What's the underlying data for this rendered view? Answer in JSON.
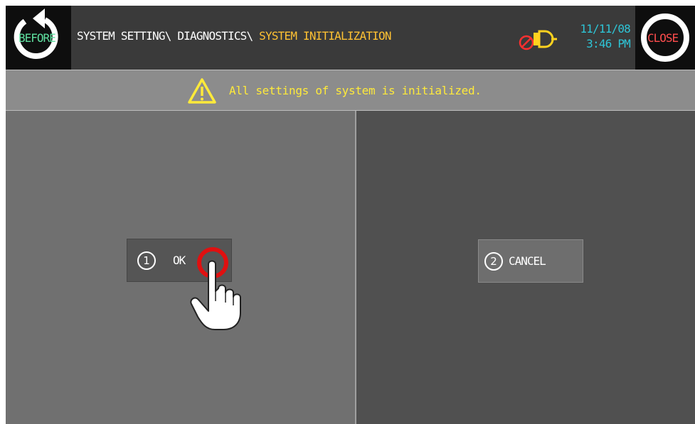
{
  "header": {
    "before_label": "BEFORE",
    "close_label": "CLOSE",
    "breadcrumb_prefix": "SYSTEM SETTING\\ DIAGNOSTICS\\ ",
    "breadcrumb_current": "SYSTEM INITIALIZATION",
    "date": "11/11/08",
    "time": "3:46 PM",
    "buzzer_icon": "buzzer-muted-icon"
  },
  "message": {
    "icon": "warning-icon",
    "text": "All settings of system is initialized."
  },
  "buttons": {
    "ok_number": "1",
    "ok_label": "OK",
    "cancel_number": "2",
    "cancel_label": "CANCEL"
  },
  "colors": {
    "breadcrumb_current": "#ffc233",
    "datetime": "#2ec4d6",
    "message_text": "#ffea3a",
    "before_text": "#5fe0a0",
    "close_text": "#ff4d4d"
  }
}
